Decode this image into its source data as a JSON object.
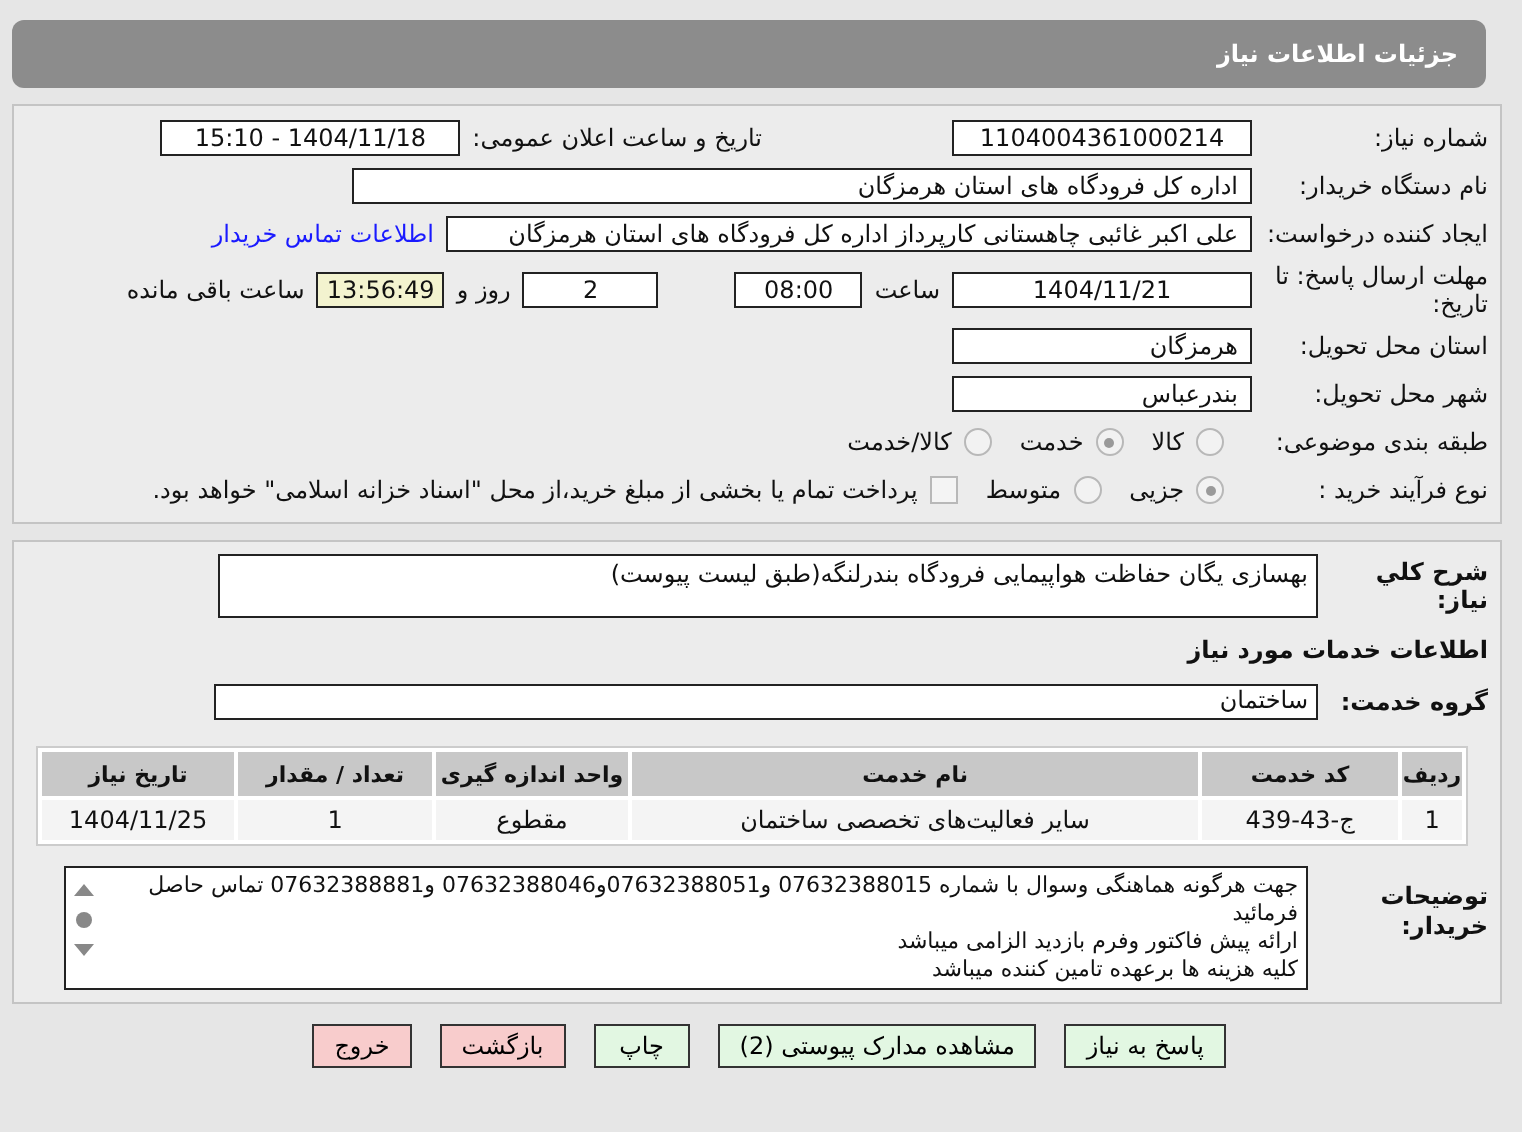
{
  "header": {
    "title": "جزئیات اطلاعات نیاز"
  },
  "need_number": {
    "label": "شماره نیاز:",
    "value": "1104004361000214"
  },
  "announce": {
    "label": "تاریخ و ساعت اعلان عمومی:",
    "value": "1404/11/18 - 15:10"
  },
  "buyer": {
    "label": "نام دستگاه خریدار:",
    "value": "اداره کل فرودگاه های استان هرمزگان"
  },
  "creator": {
    "label": "ایجاد کننده درخواست:",
    "value": "علی اکبر غائبی چاهستانی کارپرداز اداره کل فرودگاه های استان هرمزگان",
    "link": "اطلاعات تماس خریدار"
  },
  "deadline": {
    "label": "مهلت ارسال پاسخ: تا تاریخ:",
    "date": "1404/11/21",
    "time_label": "ساعت",
    "time": "08:00",
    "days": "2",
    "days_label": "روز و",
    "remaining": "13:56:49",
    "remaining_label": "ساعت باقی مانده"
  },
  "province": {
    "label": "استان محل تحویل:",
    "value": "هرمزگان"
  },
  "city": {
    "label": "شهر محل تحویل:",
    "value": "بندرعباس"
  },
  "category": {
    "label": "طبقه بندی موضوعی:",
    "options": [
      {
        "label": "کالا",
        "selected": false
      },
      {
        "label": "خدمت",
        "selected": true
      },
      {
        "label": "کالا/خدمت",
        "selected": false
      }
    ]
  },
  "process": {
    "label": "نوع فرآیند خرید :",
    "options": [
      {
        "label": "جزیی",
        "selected": true
      },
      {
        "label": "متوسط",
        "selected": false
      }
    ],
    "payment": {
      "label": "پرداخت تمام یا بخشی از مبلغ خرید،از محل \"اسناد خزانه اسلامی\" خواهد بود.",
      "checked": false
    }
  },
  "description": {
    "label": "شرح کلي نياز:",
    "value": "بهسازی یگان حفاظت هواپیمایی فرودگاه بندرلنگه(طبق لیست پیوست)"
  },
  "services_title": "اطلاعات خدمات مورد نیاز",
  "service_group": {
    "label": "گروه خدمت:",
    "value": "ساختمان"
  },
  "table": {
    "columns": [
      "ردیف",
      "کد خدمت",
      "نام خدمت",
      "واحد اندازه گیری",
      "تعداد / مقدار",
      "تاریخ نیاز"
    ],
    "rows": [
      [
        "1",
        "ج-43-439",
        "سایر فعالیت‌های تخصصی ساختمان",
        "مقطوع",
        "1",
        "1404/11/25"
      ]
    ]
  },
  "buyer_notes": {
    "label": "توضیحات خریدار:",
    "lines": [
      "جهت هرگونه هماهنگی وسوال با شماره 07632388015 و07632388051و07632388046 و07632388881 تماس حاصل فرمائید",
      "ارائه پیش فاکتور وفرم بازدید الزامی میباشد",
      "کلیه هزینه ها برعهده تامین کننده میباشد"
    ]
  },
  "buttons": [
    {
      "label": "پاسخ به نیاز",
      "kind": "action"
    },
    {
      "label": "مشاهده مدارک پیوستی (2)",
      "kind": "action"
    },
    {
      "label": "چاپ",
      "kind": "action"
    },
    {
      "label": "بازگشت",
      "kind": "exit"
    },
    {
      "label": "خروج",
      "kind": "exit"
    }
  ]
}
